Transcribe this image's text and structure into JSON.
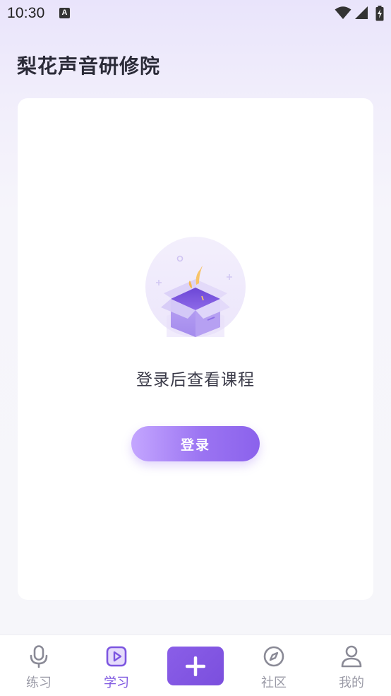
{
  "status_bar": {
    "time": "10:30",
    "notification_icon_letter": "A",
    "icons": [
      "wifi-icon",
      "signal-icon",
      "battery-charging-icon"
    ]
  },
  "header": {
    "title": "梨花声音研修院"
  },
  "empty_state": {
    "illustration": "open-box-icon",
    "message": "登录后查看课程",
    "login_button_label": "登录"
  },
  "bottom_nav": {
    "items": [
      {
        "label": "练习",
        "icon": "microphone-icon",
        "active": false
      },
      {
        "label": "学习",
        "icon": "video-play-icon",
        "active": true
      },
      {
        "label": "",
        "icon": "plus-icon",
        "active": false
      },
      {
        "label": "社区",
        "icon": "compass-icon",
        "active": false
      },
      {
        "label": "我的",
        "icon": "user-icon",
        "active": false
      }
    ]
  },
  "colors": {
    "accent": "#7c55e0",
    "inactive": "#9a9aa6",
    "title": "#2b2b38"
  }
}
